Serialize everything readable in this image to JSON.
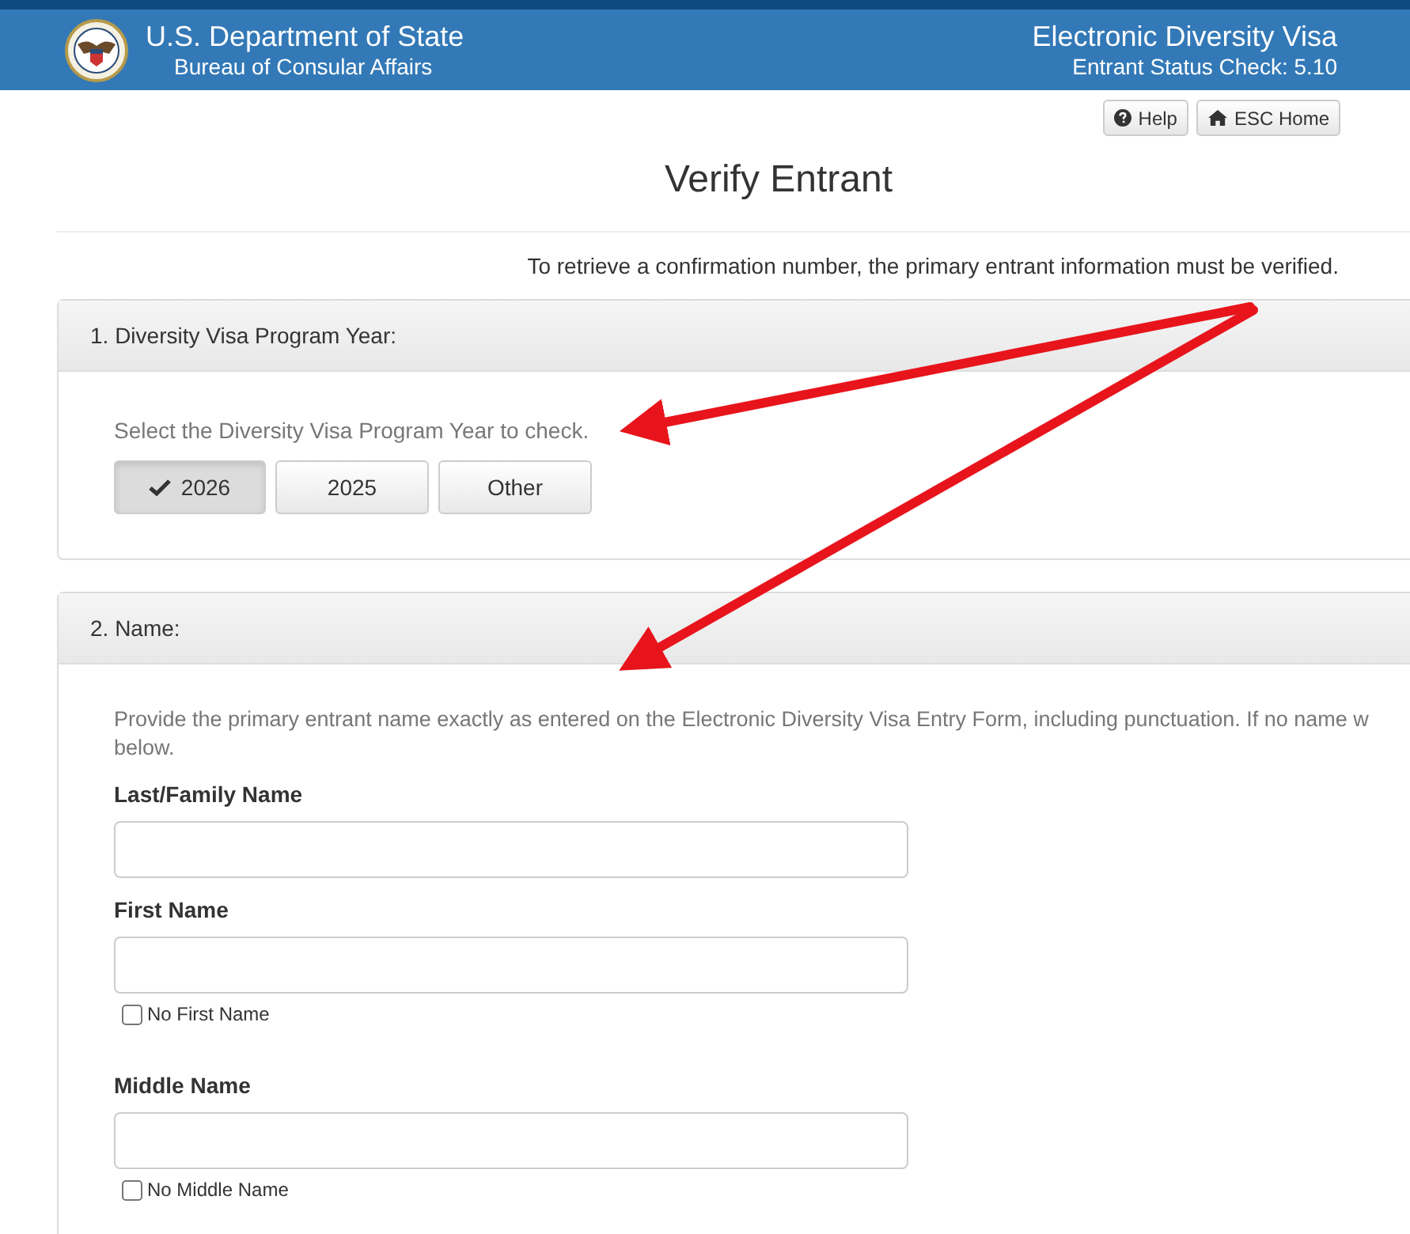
{
  "header": {
    "agency": "U.S. Department of State",
    "bureau": "Bureau of Consular Affairs",
    "app_title": "Electronic Diversity Visa",
    "app_subtitle": "Entrant Status Check: 5.10"
  },
  "toolbar": [
    {
      "label": "Help",
      "kind": "help"
    },
    {
      "label": "ESC Home",
      "kind": "home"
    }
  ],
  "page_title": "Verify Entrant",
  "intro": "To retrieve a confirmation number, the primary entrant information must be verified.",
  "year_section": {
    "heading": "1. Diversity Visa Program Year:",
    "prompt": "Select the Diversity Visa Program Year to check.",
    "options": [
      {
        "label": "2026",
        "selected": true
      },
      {
        "label": "2025",
        "selected": false
      },
      {
        "label": "Other",
        "selected": false
      }
    ]
  },
  "name_section": {
    "heading": "2. Name:",
    "instructions": [
      "Provide the primary entrant name exactly as entered on the Electronic Diversity Visa Entry Form, including punctuation. If no name w",
      "below."
    ],
    "fields": [
      {
        "label": "Last/Family Name"
      },
      {
        "label": "First Name",
        "checkbox": {
          "label": "No First Name",
          "checked": false
        }
      },
      {
        "label": "Middle Name",
        "checkbox": {
          "label": "No Middle Name",
          "checked": false
        }
      }
    ]
  }
}
